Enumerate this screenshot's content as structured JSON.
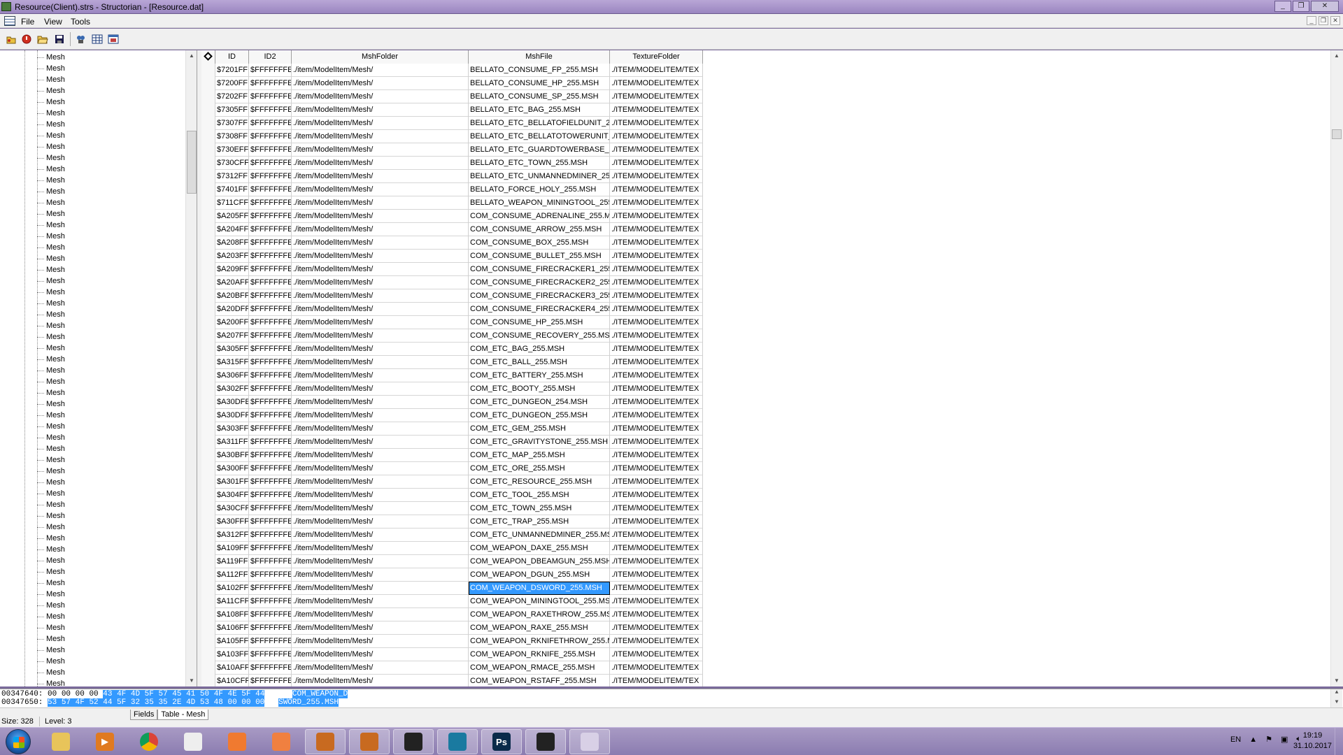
{
  "window": {
    "title": "Resource(Client).strs - Structorian - [Resource.dat]",
    "buttons": [
      "_",
      "❐",
      "✕"
    ]
  },
  "menu": {
    "items": [
      "File",
      "View",
      "Tools"
    ],
    "mdi_controls": [
      "_",
      "❐",
      "✕"
    ]
  },
  "toolbar": {
    "icons": [
      "open-structures-icon",
      "reload-icon",
      "open-file-icon",
      "save-icon",
      "find-icon",
      "table-view-icon",
      "hex-view-icon"
    ]
  },
  "tree": {
    "item_label": "Mesh",
    "count": 57
  },
  "grid": {
    "columns": [
      "",
      "ID",
      "ID2",
      "MshFolder",
      "MshFile",
      "TextureFolder"
    ],
    "rows": [
      [
        "$7201FF",
        "$FFFFFFFE",
        "./item/ModelItem/Mesh/",
        "BELLATO_CONSUME_FP_255.MSH",
        "./ITEM/MODELITEM/TEX"
      ],
      [
        "$7200FF",
        "$FFFFFFFE",
        "./item/ModelItem/Mesh/",
        "BELLATO_CONSUME_HP_255.MSH",
        "./ITEM/MODELITEM/TEX"
      ],
      [
        "$7202FF",
        "$FFFFFFFE",
        "./item/ModelItem/Mesh/",
        "BELLATO_CONSUME_SP_255.MSH",
        "./ITEM/MODELITEM/TEX"
      ],
      [
        "$7305FF",
        "$FFFFFFFE",
        "./item/ModelItem/Mesh/",
        "BELLATO_ETC_BAG_255.MSH",
        "./ITEM/MODELITEM/TEX"
      ],
      [
        "$7307FF",
        "$FFFFFFFE",
        "./item/ModelItem/Mesh/",
        "BELLATO_ETC_BELLATOFIELDUNIT_2",
        "./ITEM/MODELITEM/TEX"
      ],
      [
        "$7308FF",
        "$FFFFFFFE",
        "./item/ModelItem/Mesh/",
        "BELLATO_ETC_BELLATOTOWERUNIT_",
        "./ITEM/MODELITEM/TEX"
      ],
      [
        "$730EFF",
        "$FFFFFFFE",
        "./item/ModelItem/Mesh/",
        "BELLATO_ETC_GUARDTOWERBASE_2",
        "./ITEM/MODELITEM/TEX"
      ],
      [
        "$730CFF",
        "$FFFFFFFE",
        "./item/ModelItem/Mesh/",
        "BELLATO_ETC_TOWN_255.MSH",
        "./ITEM/MODELITEM/TEX"
      ],
      [
        "$7312FF",
        "$FFFFFFFE",
        "./item/ModelItem/Mesh/",
        "BELLATO_ETC_UNMANNEDMINER_25",
        "./ITEM/MODELITEM/TEX"
      ],
      [
        "$7401FF",
        "$FFFFFFFE",
        "./item/ModelItem/Mesh/",
        "BELLATO_FORCE_HOLY_255.MSH",
        "./ITEM/MODELITEM/TEX"
      ],
      [
        "$711CFF",
        "$FFFFFFFE",
        "./item/ModelItem/Mesh/",
        "BELLATO_WEAPON_MININGTOOL_255",
        "./ITEM/MODELITEM/TEX"
      ],
      [
        "$A205FF",
        "$FFFFFFFE",
        "./item/ModelItem/Mesh/",
        "COM_CONSUME_ADRENALINE_255.MS",
        "./ITEM/MODELITEM/TEX"
      ],
      [
        "$A204FF",
        "$FFFFFFFE",
        "./item/ModelItem/Mesh/",
        "COM_CONSUME_ARROW_255.MSH",
        "./ITEM/MODELITEM/TEX"
      ],
      [
        "$A208FF",
        "$FFFFFFFE",
        "./item/ModelItem/Mesh/",
        "COM_CONSUME_BOX_255.MSH",
        "./ITEM/MODELITEM/TEX"
      ],
      [
        "$A203FF",
        "$FFFFFFFE",
        "./item/ModelItem/Mesh/",
        "COM_CONSUME_BULLET_255.MSH",
        "./ITEM/MODELITEM/TEX"
      ],
      [
        "$A209FF",
        "$FFFFFFFE",
        "./item/ModelItem/Mesh/",
        "COM_CONSUME_FIRECRACKER1_255.",
        "./ITEM/MODELITEM/TEX"
      ],
      [
        "$A20AFF",
        "$FFFFFFFE",
        "./item/ModelItem/Mesh/",
        "COM_CONSUME_FIRECRACKER2_255.",
        "./ITEM/MODELITEM/TEX"
      ],
      [
        "$A20BFF",
        "$FFFFFFFE",
        "./item/ModelItem/Mesh/",
        "COM_CONSUME_FIRECRACKER3_255.",
        "./ITEM/MODELITEM/TEX"
      ],
      [
        "$A20DFF",
        "$FFFFFFFE",
        "./item/ModelItem/Mesh/",
        "COM_CONSUME_FIRECRACKER4_255.",
        "./ITEM/MODELITEM/TEX"
      ],
      [
        "$A200FF",
        "$FFFFFFFE",
        "./item/ModelItem/Mesh/",
        "COM_CONSUME_HP_255.MSH",
        "./ITEM/MODELITEM/TEX"
      ],
      [
        "$A207FF",
        "$FFFFFFFE",
        "./item/ModelItem/Mesh/",
        "COM_CONSUME_RECOVERY_255.MSH",
        "./ITEM/MODELITEM/TEX"
      ],
      [
        "$A305FF",
        "$FFFFFFFE",
        "./item/ModelItem/Mesh/",
        "COM_ETC_BAG_255.MSH",
        "./ITEM/MODELITEM/TEX"
      ],
      [
        "$A315FF",
        "$FFFFFFFE",
        "./item/ModelItem/Mesh/",
        "COM_ETC_BALL_255.MSH",
        "./ITEM/MODELITEM/TEX"
      ],
      [
        "$A306FF",
        "$FFFFFFFE",
        "./item/ModelItem/Mesh/",
        "COM_ETC_BATTERY_255.MSH",
        "./ITEM/MODELITEM/TEX"
      ],
      [
        "$A302FF",
        "$FFFFFFFE",
        "./item/ModelItem/Mesh/",
        "COM_ETC_BOOTY_255.MSH",
        "./ITEM/MODELITEM/TEX"
      ],
      [
        "$A30DFE",
        "$FFFFFFFE",
        "./item/ModelItem/Mesh/",
        "COM_ETC_DUNGEON_254.MSH",
        "./ITEM/MODELITEM/TEX"
      ],
      [
        "$A30DFF",
        "$FFFFFFFE",
        "./item/ModelItem/Mesh/",
        "COM_ETC_DUNGEON_255.MSH",
        "./ITEM/MODELITEM/TEX"
      ],
      [
        "$A303FF",
        "$FFFFFFFE",
        "./item/ModelItem/Mesh/",
        "COM_ETC_GEM_255.MSH",
        "./ITEM/MODELITEM/TEX"
      ],
      [
        "$A311FF",
        "$FFFFFFFE",
        "./item/ModelItem/Mesh/",
        "COM_ETC_GRAVITYSTONE_255.MSH",
        "./ITEM/MODELITEM/TEX"
      ],
      [
        "$A30BFF",
        "$FFFFFFFE",
        "./item/ModelItem/Mesh/",
        "COM_ETC_MAP_255.MSH",
        "./ITEM/MODELITEM/TEX"
      ],
      [
        "$A300FF",
        "$FFFFFFFE",
        "./item/ModelItem/Mesh/",
        "COM_ETC_ORE_255.MSH",
        "./ITEM/MODELITEM/TEX"
      ],
      [
        "$A301FF",
        "$FFFFFFFE",
        "./item/ModelItem/Mesh/",
        "COM_ETC_RESOURCE_255.MSH",
        "./ITEM/MODELITEM/TEX"
      ],
      [
        "$A304FF",
        "$FFFFFFFE",
        "./item/ModelItem/Mesh/",
        "COM_ETC_TOOL_255.MSH",
        "./ITEM/MODELITEM/TEX"
      ],
      [
        "$A30CFF",
        "$FFFFFFFE",
        "./item/ModelItem/Mesh/",
        "COM_ETC_TOWN_255.MSH",
        "./ITEM/MODELITEM/TEX"
      ],
      [
        "$A30FFF",
        "$FFFFFFFE",
        "./item/ModelItem/Mesh/",
        "COM_ETC_TRAP_255.MSH",
        "./ITEM/MODELITEM/TEX"
      ],
      [
        "$A312FF",
        "$FFFFFFFE",
        "./item/ModelItem/Mesh/",
        "COM_ETC_UNMANNEDMINER_255.MS",
        "./ITEM/MODELITEM/TEX"
      ],
      [
        "$A109FF",
        "$FFFFFFFE",
        "./item/ModelItem/Mesh/",
        "COM_WEAPON_DAXE_255.MSH",
        "./ITEM/MODELITEM/TEX"
      ],
      [
        "$A119FF",
        "$FFFFFFFE",
        "./item/ModelItem/Mesh/",
        "COM_WEAPON_DBEAMGUN_255.MSH",
        "./ITEM/MODELITEM/TEX"
      ],
      [
        "$A112FF",
        "$FFFFFFFE",
        "./item/ModelItem/Mesh/",
        "COM_WEAPON_DGUN_255.MSH",
        "./ITEM/MODELITEM/TEX"
      ],
      [
        "$A102FF",
        "$FFFFFFFE",
        "./item/ModelItem/Mesh/",
        "COM_WEAPON_DSWORD_255.MSH",
        "./ITEM/MODELITEM/TEX"
      ],
      [
        "$A11CFF",
        "$FFFFFFFE",
        "./item/ModelItem/Mesh/",
        "COM_WEAPON_MININGTOOL_255.MSH",
        "./ITEM/MODELITEM/TEX"
      ],
      [
        "$A108FF",
        "$FFFFFFFE",
        "./item/ModelItem/Mesh/",
        "COM_WEAPON_RAXETHROW_255.MS",
        "./ITEM/MODELITEM/TEX"
      ],
      [
        "$A106FF",
        "$FFFFFFFE",
        "./item/ModelItem/Mesh/",
        "COM_WEAPON_RAXE_255.MSH",
        "./ITEM/MODELITEM/TEX"
      ],
      [
        "$A105FF",
        "$FFFFFFFE",
        "./item/ModelItem/Mesh/",
        "COM_WEAPON_RKNIFETHROW_255.M",
        "./ITEM/MODELITEM/TEX"
      ],
      [
        "$A103FF",
        "$FFFFFFFE",
        "./item/ModelItem/Mesh/",
        "COM_WEAPON_RKNIFE_255.MSH",
        "./ITEM/MODELITEM/TEX"
      ],
      [
        "$A10AFF",
        "$FFFFFFFE",
        "./item/ModelItem/Mesh/",
        "COM_WEAPON_RMACE_255.MSH",
        "./ITEM/MODELITEM/TEX"
      ],
      [
        "$A10CFF",
        "$FFFFFFFE",
        "./item/ModelItem/Mesh/",
        "COM_WEAPON_RSTAFF_255.MSH",
        "./ITEM/MODELITEM/TEX"
      ]
    ],
    "selected_row": 39
  },
  "hex": {
    "lines": [
      {
        "addr": "00347640:",
        "plain": "00 00 00 00",
        "sel": "43 4F 4D 5F 57 45 41 50 4F 4E 5F 44",
        "ascii_sel": "COM_WEAPON_D"
      },
      {
        "addr": "00347650:",
        "plain": "",
        "sel": "53 57 4F 52 44 5F 32 35 35 2E 4D 53 48 00 00 00",
        "ascii_sel": "SWORD_255.MSH"
      }
    ]
  },
  "status": {
    "size": "Size: 328",
    "level": "Level: 3",
    "tabs": [
      "Fields",
      "Table - Mesh"
    ]
  },
  "taskbar": {
    "apps": [
      {
        "name": "explorer",
        "label": "",
        "color": "#e8c45a"
      },
      {
        "name": "media-player",
        "label": "▶",
        "color": "#e07a20"
      },
      {
        "name": "chrome",
        "label": "",
        "color": "#3a9a3a"
      },
      {
        "name": "app-panda",
        "label": "",
        "color": "#eeeeee"
      },
      {
        "name": "app-orange-1",
        "label": "",
        "color": "#f07a30"
      },
      {
        "name": "app-orange-2",
        "label": "",
        "color": "#f08040"
      },
      {
        "name": "app-rf-1",
        "label": "",
        "color": "#c86a20"
      },
      {
        "name": "app-rf-2",
        "label": "",
        "color": "#c86a20"
      },
      {
        "name": "app-rf-3",
        "label": "",
        "color": "#222222"
      },
      {
        "name": "app-structorian",
        "label": "",
        "color": "#1a7aa0"
      },
      {
        "name": "photoshop",
        "label": "Ps",
        "color": "#0a2a4a"
      },
      {
        "name": "app-rf-4",
        "label": "",
        "color": "#222222"
      },
      {
        "name": "app-blank",
        "label": "",
        "color": "#d8d0e6"
      }
    ],
    "lang": "EN",
    "time": "19:19",
    "date": "31.10.2017"
  }
}
